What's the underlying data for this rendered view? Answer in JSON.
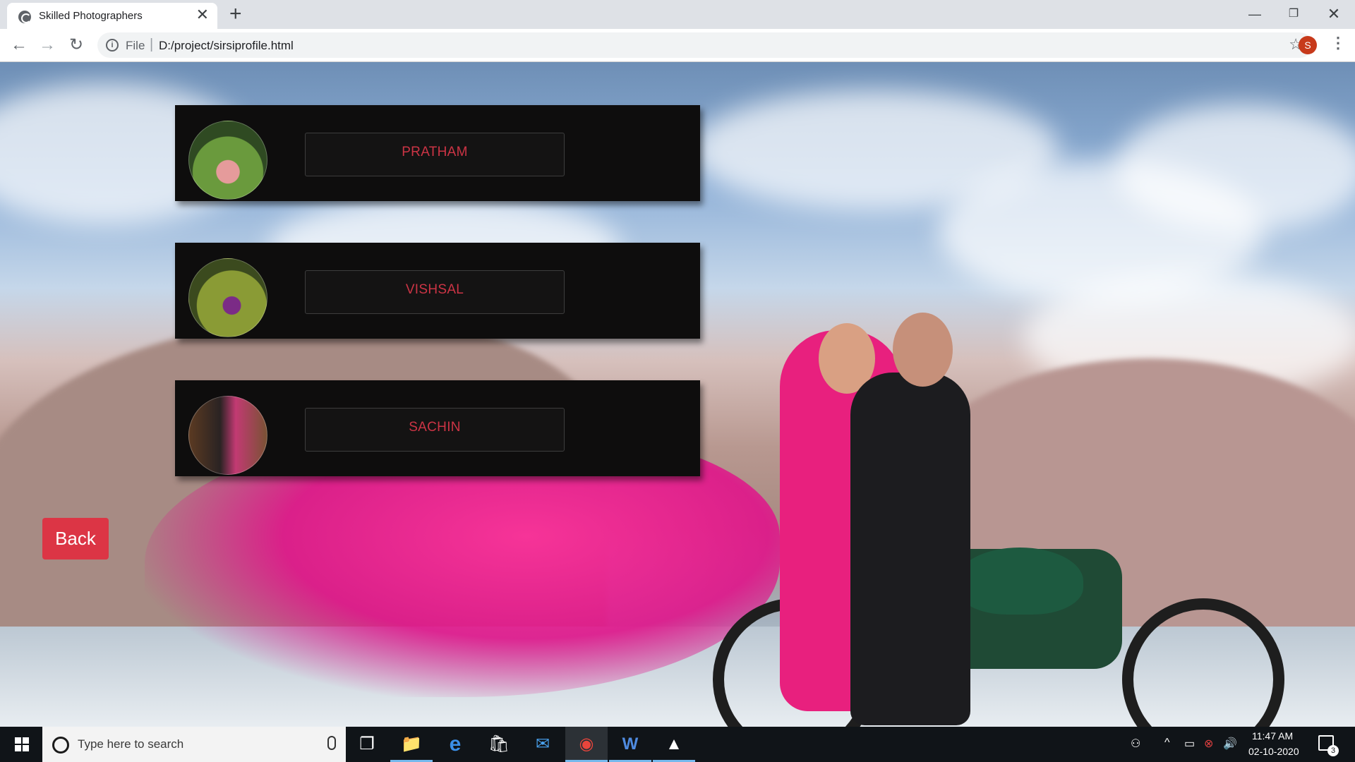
{
  "browser": {
    "tab_title": "Skilled Photographers",
    "new_tab_label": "+",
    "close_tab_label": "✕",
    "window_controls": {
      "minimize": "—",
      "maximize": "❐",
      "close": "✕"
    },
    "nav": {
      "back": "←",
      "forward": "→",
      "reload": "↻"
    },
    "address_bar": {
      "info_icon": "i",
      "scheme_label": "File",
      "separator": "|",
      "url": "D:/project/sirsiprofile.html",
      "bookmark_icon": "☆"
    },
    "profile_initial": "S",
    "menu_icon": "⋮"
  },
  "page": {
    "photographers": [
      {
        "name": "PRATHAM",
        "avatar_icon": "couple-photo-icon"
      },
      {
        "name": "VISHSAL",
        "avatar_icon": "couple-photo-icon"
      },
      {
        "name": "SACHIN",
        "avatar_icon": "couple-photo-icon"
      }
    ],
    "back_label": "Back",
    "colors": {
      "card_background": "#0e0d0d",
      "name_text": "#cc3445",
      "back_button": "#dc3545"
    }
  },
  "taskbar": {
    "search_placeholder": "Type here to search",
    "apps": [
      {
        "name": "task-view-icon",
        "glyph": "❐"
      },
      {
        "name": "file-explorer-icon",
        "glyph": "📁"
      },
      {
        "name": "edge-icon",
        "glyph": "e"
      },
      {
        "name": "store-icon",
        "glyph": "🛍"
      },
      {
        "name": "mail-icon",
        "glyph": "✉"
      },
      {
        "name": "chrome-icon",
        "glyph": "◉"
      },
      {
        "name": "word-icon",
        "glyph": "W"
      },
      {
        "name": "photos-icon",
        "glyph": "▲"
      }
    ],
    "tray": {
      "people": "⚇",
      "chevron": "^",
      "battery": "▭",
      "network": "⊗",
      "volume": "🔊"
    },
    "time": "11:47 AM",
    "date": "02-10-2020",
    "notification_count": "3"
  }
}
